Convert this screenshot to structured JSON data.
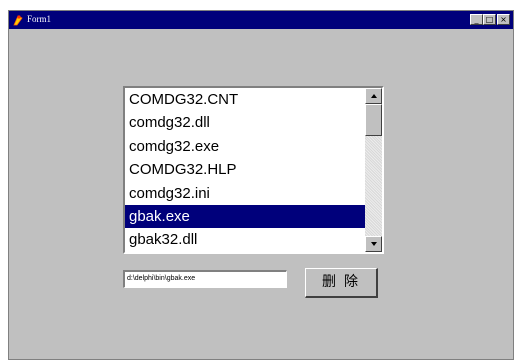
{
  "window": {
    "title": "Form1",
    "controls": {
      "minimize": "_",
      "maximize": "□",
      "close": "×"
    }
  },
  "file_list": {
    "items": [
      "COMDG32.CNT",
      "comdg32.dll",
      "comdg32.exe",
      "COMDG32.HLP",
      "comdg32.ini",
      "gbak.exe",
      "gbak32.dll"
    ],
    "selected_index": 5
  },
  "path_field": {
    "value": "d:\\delphi\\bin\\gbak.exe"
  },
  "delete_button": {
    "label": "删除"
  },
  "colors": {
    "titlebar": "#00007b",
    "selection": "#00007b",
    "face": "#c0c0c0"
  }
}
